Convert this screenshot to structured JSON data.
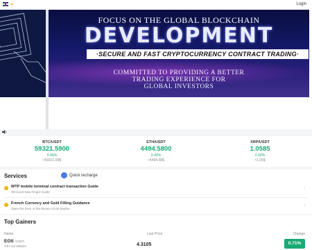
{
  "header": {
    "login_label": "Login",
    "language_icon": "uk-flag-icon"
  },
  "banner": {
    "headline": "FOCUS ON THE GLOBAL BLOCKCHAIN",
    "title": "DEVELOPMENT",
    "tagline": "·SECURE AND FAST CRYPTOCURRENCY CONTRACT TRADING·",
    "sub_line1": "COMMITTED TO PROVIDING A BETTER",
    "sub_line2": "TRADING EXPERIENCE FOR",
    "sub_line3": "GLOBAL INVESTORS"
  },
  "tickers": [
    {
      "pair": "BTC/USDT",
      "price": "59321.5900",
      "pct": "0.46%",
      "approx": "≈59321.59$"
    },
    {
      "pair": "ETH/USDT",
      "price": "4494.5800",
      "pct": "0.43%",
      "approx": "≈4494.58$"
    },
    {
      "pair": "XRP/USDT",
      "price": "1.0585",
      "pct": "0.92%",
      "approx": "≈1.05$"
    }
  ],
  "services": {
    "title": "Services",
    "quick_recharge": "Quick recharge",
    "items": [
      {
        "title": "WTP mobile terminal contract transaction Guide",
        "subtitle": "All-round New Finger Guide"
      },
      {
        "title": "French Currency and Gold Filling Guidance",
        "subtitle": "Open the Door of the Money Circle Market"
      }
    ]
  },
  "gainers": {
    "title": "Top Gainers",
    "col_name": "Name",
    "col_last": "Last Price",
    "col_change": "Change",
    "rows": [
      {
        "symbol": "EOS",
        "quote": "/USDT",
        "volume": "24H Vol 169321",
        "last": "4.3105",
        "change": "0.71%"
      }
    ]
  },
  "colors": {
    "up": "#19a974",
    "banner_bg": "#141a6a"
  }
}
